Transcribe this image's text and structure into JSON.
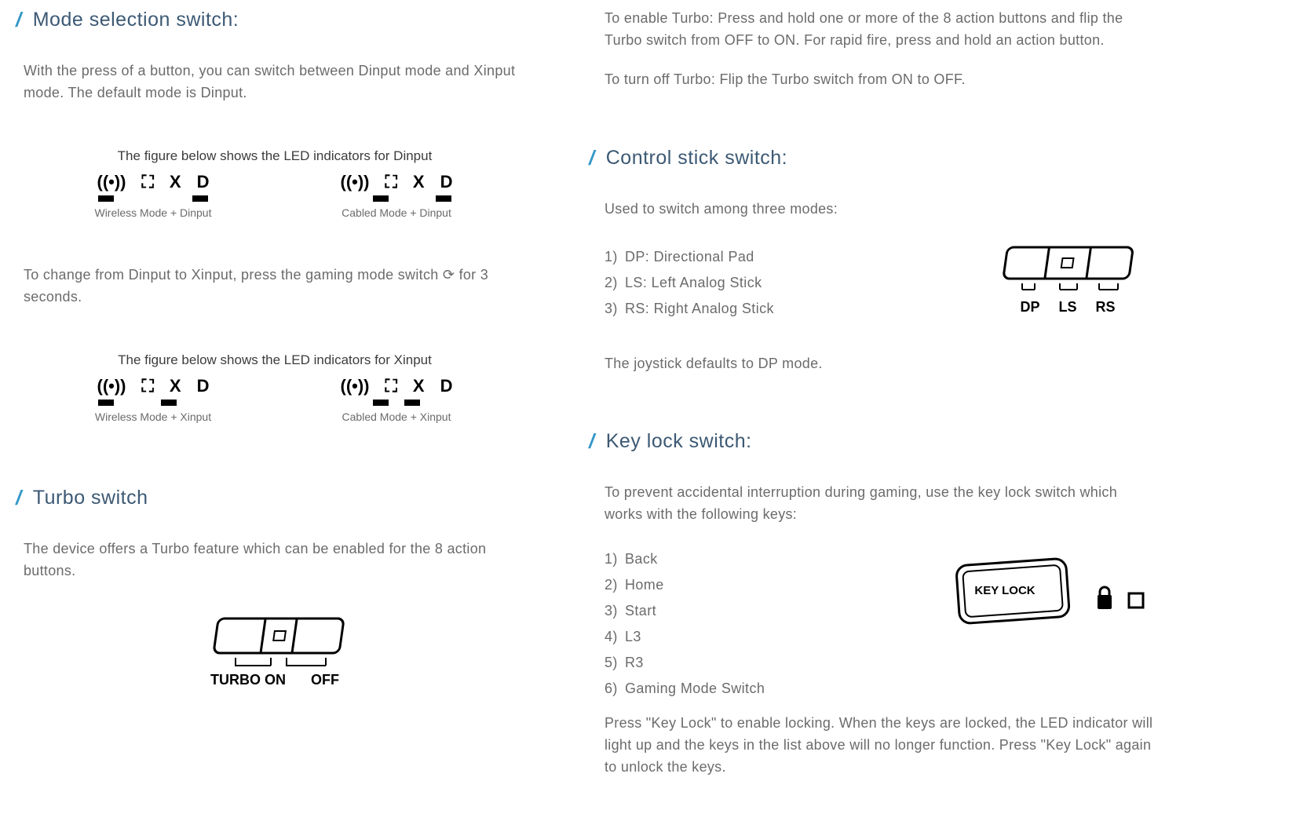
{
  "left": {
    "mode_section": {
      "title": "Mode selection switch:",
      "intro": "With the press of a button, you can switch between Dinput mode and Xinput mode. The default mode is Dinput.",
      "dinput_caption": "The figure below shows the LED indicators for Dinput",
      "wireless_dinput": "Wireless Mode + Dinput",
      "cabled_dinput": "Cabled Mode + Dinput",
      "change_text_1": "To change from Dinput to Xinput, press the gaming mode switch ",
      "change_text_2": " for 3 seconds.",
      "xinput_caption": "The figure below shows the LED indicators for Xinput",
      "wireless_xinput": "Wireless Mode + Xinput",
      "cabled_xinput": "Cabled Mode + Xinput"
    },
    "turbo_section": {
      "title": "Turbo switch",
      "intro": "The device offers a Turbo feature which can be enabled for the 8 action buttons.",
      "label_on": "TURBO ON",
      "label_off": "OFF"
    }
  },
  "right": {
    "turbo_cont": {
      "enable": "To enable Turbo: Press and hold one or more of the 8 action buttons and flip the Turbo switch from OFF to ON. For rapid fire, press and hold an action button.",
      "disable": "To turn off Turbo: Flip the Turbo switch from ON to OFF."
    },
    "control_section": {
      "title": "Control stick switch:",
      "intro": "Used to switch among three modes:",
      "items": [
        "DP: Directional Pad",
        "LS: Left Analog Stick",
        "RS: Right Analog Stick"
      ],
      "dp": "DP",
      "ls": "LS",
      "rs": "RS",
      "note": "The joystick defaults to DP mode."
    },
    "keylock_section": {
      "title": "Key lock switch:",
      "intro": "To prevent accidental interruption during gaming, use the key lock switch which works with the following keys:",
      "items": [
        "Back",
        "Home",
        "Start",
        "L3",
        "R3",
        "Gaming Mode Switch"
      ],
      "btn_label": "KEY LOCK",
      "footer": "Press \"Key Lock\" to enable locking. When the keys are locked, the LED indicator will light up and the keys in the list above will no longer function. Press \"Key Lock\" again to unlock the keys."
    }
  }
}
